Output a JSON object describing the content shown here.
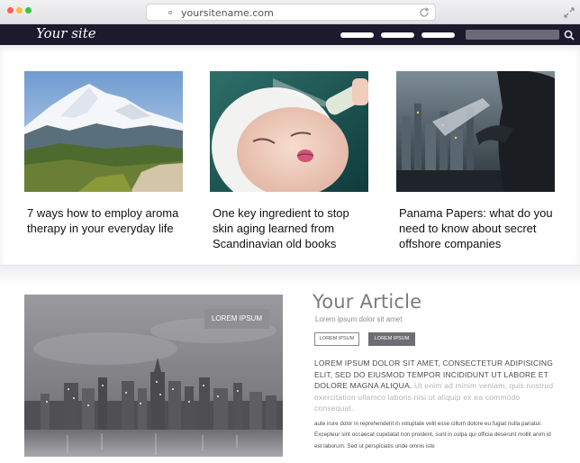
{
  "browser": {
    "url": "yoursitename.com",
    "window_controls": [
      "close",
      "minimize",
      "maximize"
    ],
    "icons": [
      "lock-icon",
      "reload-icon",
      "resize-icon"
    ]
  },
  "nav": {
    "logo": "Your site",
    "links": [
      "",
      "",
      ""
    ],
    "search_placeholder": "",
    "search_icon": "search-icon"
  },
  "cards": [
    {
      "image": "snowy mountain landscape",
      "title": "7 ways how to employ aroma therapy in your everyday life"
    },
    {
      "image": "woman receiving facial spray treatment",
      "title": "One key ingredient to stop skin aging learned from Scandinavian old books"
    },
    {
      "image": "businessman with documents over night city",
      "title": "Panama Papers: what do you need to know about secret offshore companies"
    }
  ],
  "hero": {
    "image": "grayscale city skyline at night",
    "tag": "LOREM IPSUM"
  },
  "article": {
    "title": "Your Article",
    "subtitle": "Lorem ipsum dolor sit amet",
    "button_outline": "LOREM IPSUM",
    "button_filled": "LOREM IPSUM",
    "para_caps_dark": "LOREM IPSUM DOLOR SIT AMET, CONSECTETUR ADIPISICING ELIT, SED DO EIUSMOD TEMPOR INCIDIDUNT UT LABORE ET DOLORE MAGNA ALIQUA.",
    "para_caps_faded": " Ut enim ad minim veniam, quis nostrud exercitation ullamco laboris nisi ut aliquip ex ea commodo consequat.",
    "para_small": " aute irure dolor in reprehenderit in voluptate velit esse cillum dolore eu fugiat nulla pariatur. Excepteur sint occaecat cupidatat non proident, sunt in culpa qui officia deserunt mollit anim id est laborum. Sed ut perspiciatis unde omnis iste"
  },
  "colors": {
    "nav_bg": "#1d1a2d",
    "title_gray": "#7b7b80",
    "button_filled": "#6d6d73"
  }
}
